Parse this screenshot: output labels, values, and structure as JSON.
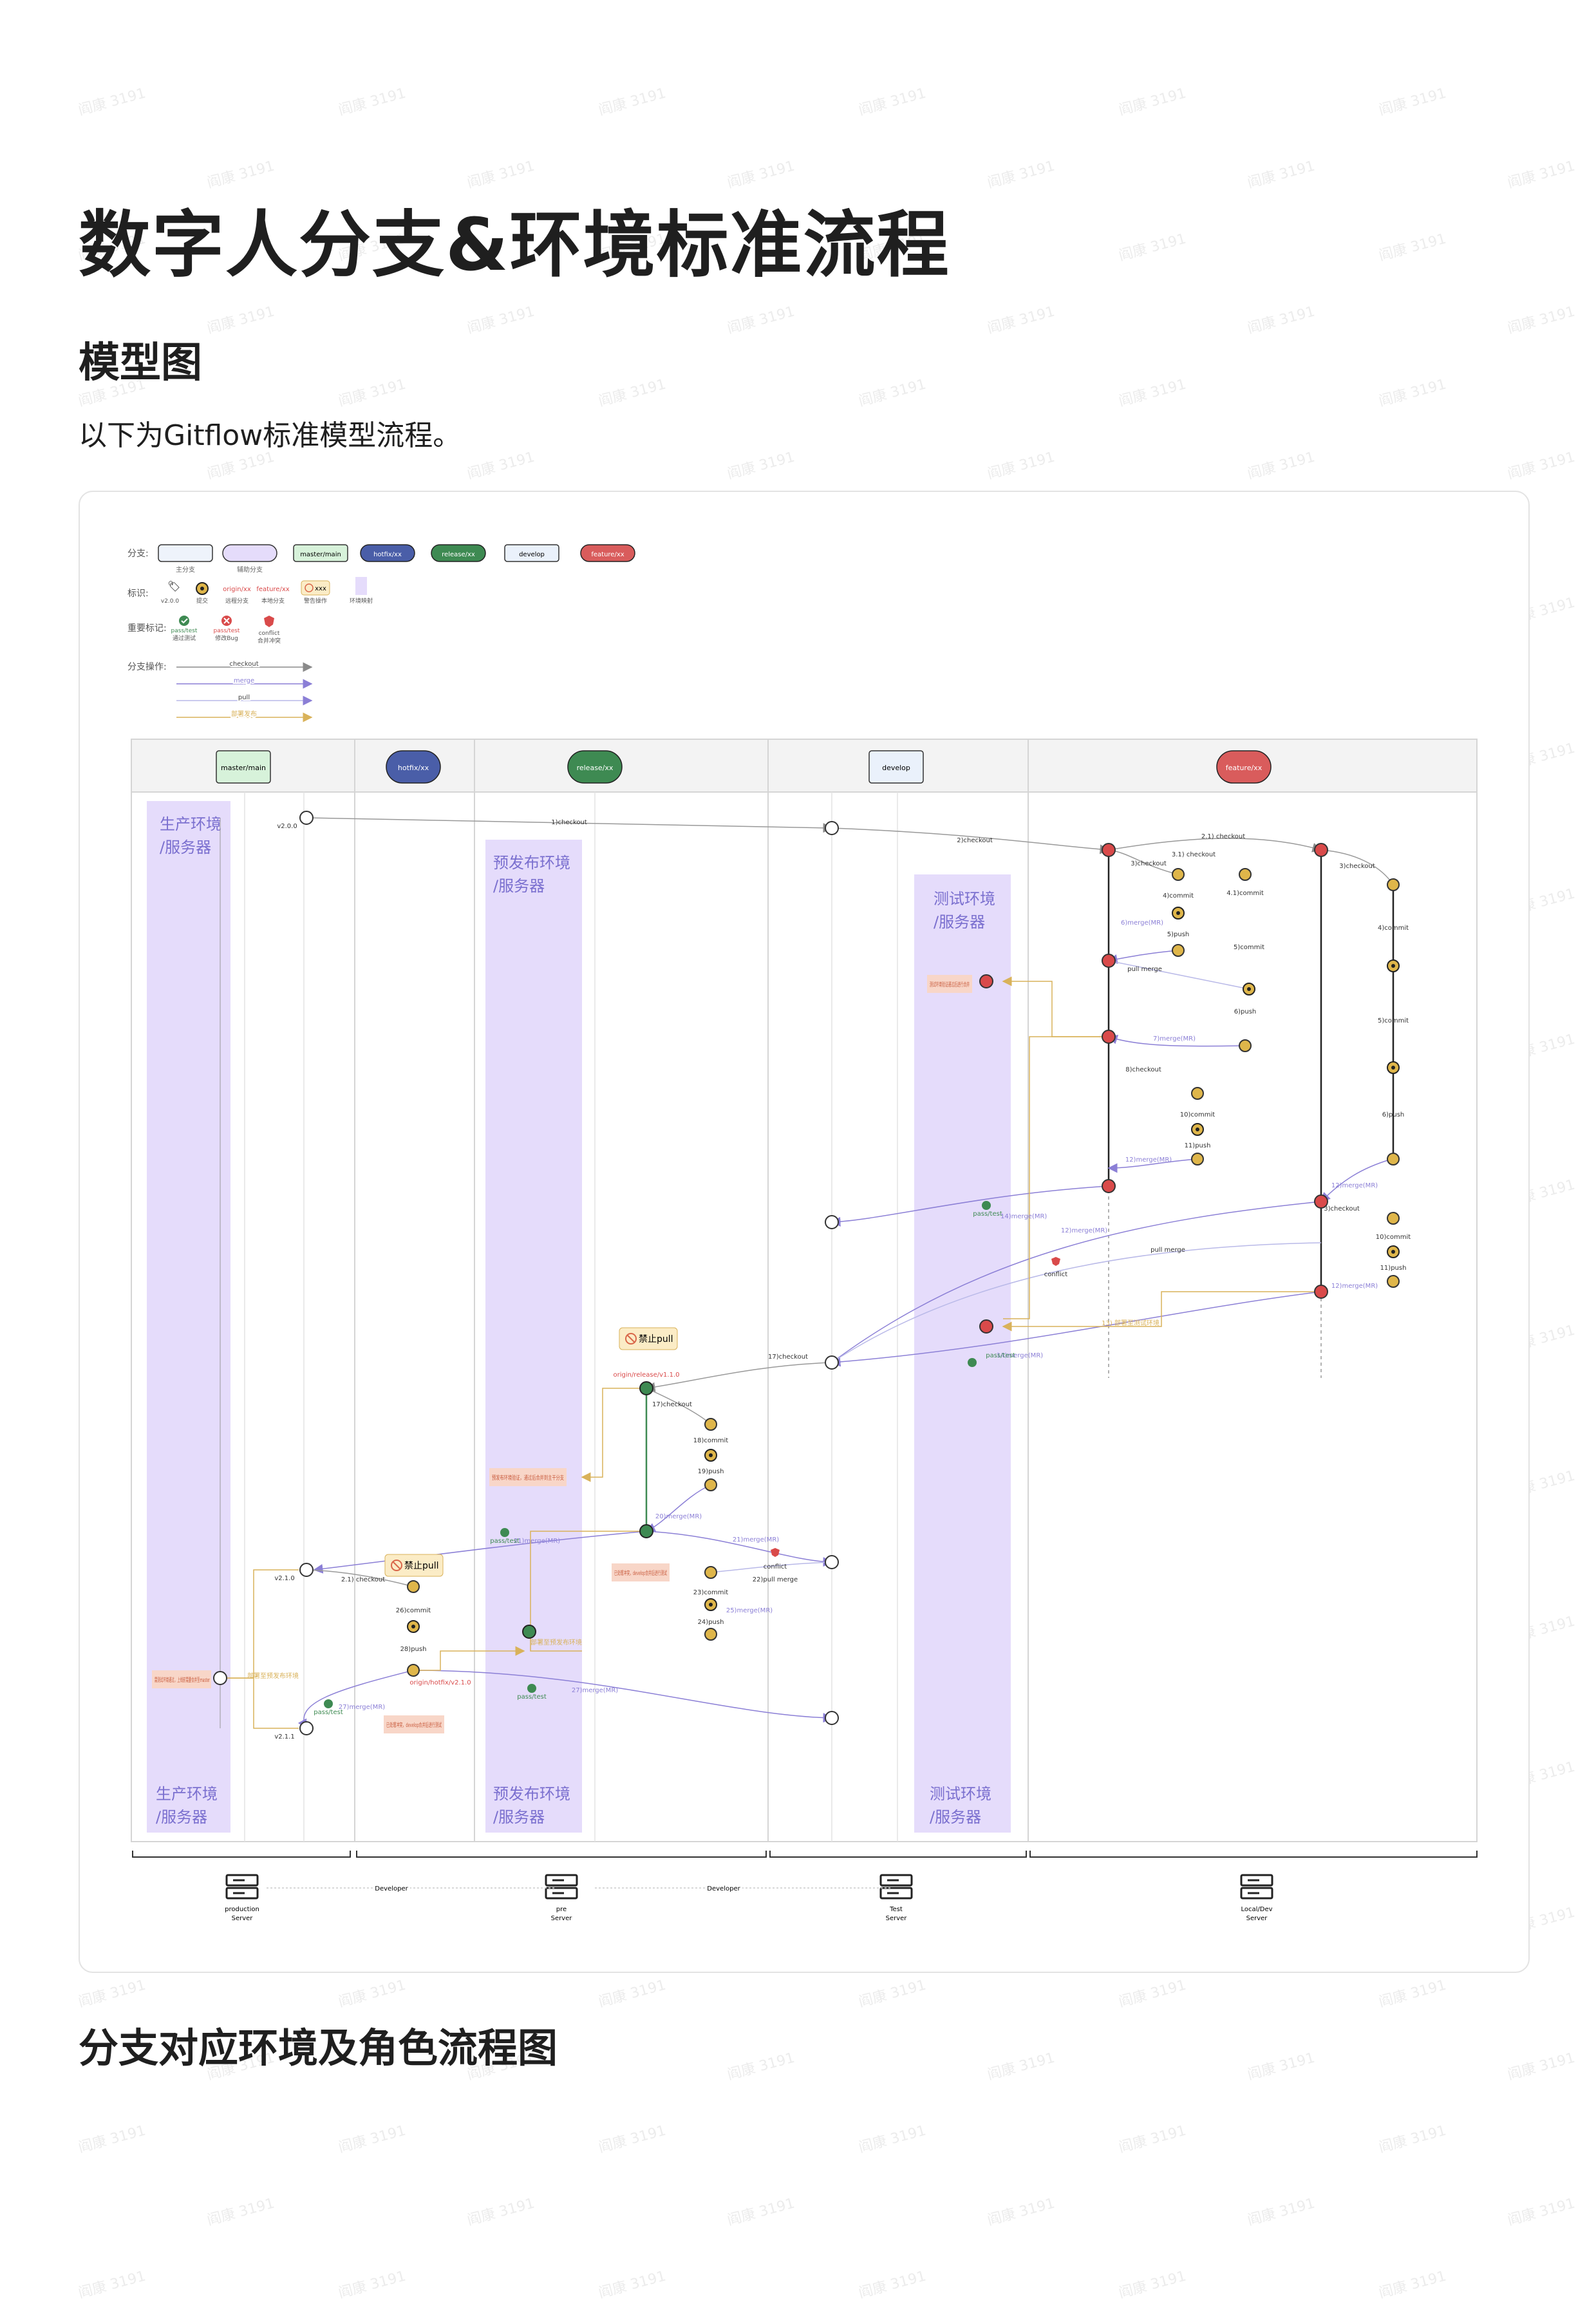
{
  "title": "数字人分支&环境标准流程",
  "section1": {
    "heading": "模型图",
    "text": "以下为Gitflow标准模型流程。"
  },
  "section2": {
    "heading": "分支对应环境及角色流程图"
  },
  "watermark": "阎康 3191",
  "legend": {
    "branch_label": "分支:",
    "branch_types": [
      "master/main",
      "hotfix/xx",
      "release/xx",
      "develop",
      "feature/xx"
    ],
    "branch_sublabels": [
      "主分支",
      "辅助分支"
    ],
    "marker_label": "标识:",
    "marker_items": [
      "v2.0.0",
      "提交",
      "origin/xx",
      "远程分支",
      "feature/xx",
      "本地分支",
      "xxx",
      "警告操作",
      "环境映射"
    ],
    "important_label": "重要标记:",
    "important_items": [
      "pass/test",
      "通过测试",
      "pass/test",
      "修改Bug",
      "conflict",
      "合并冲突"
    ],
    "ops_label": "分支操作:",
    "ops": [
      "checkout",
      "merge",
      "pull",
      "部署发布"
    ]
  },
  "columns": {
    "headers": [
      "master/main",
      "hotfix/xx",
      "release/xx",
      "develop",
      "feature/xx"
    ],
    "colors": {
      "master": "#d7f2da",
      "hotfix": "#4a5ea8",
      "release": "#3e8a52",
      "develop": "#eaf1fb",
      "feature": "#d95c5c",
      "env": "#e5dcfb",
      "merge": "#8b7fd6",
      "deploy": "#d9b25a",
      "node_yellow": "#dfb64a",
      "node_red": "#d94a4a",
      "node_green": "#3e8a52"
    }
  },
  "envs": {
    "prod_top": [
      "生产环境",
      "/服务器"
    ],
    "prod_bottom": [
      "生产环境",
      "/服务器"
    ],
    "pre_top": [
      "预发布环境",
      "/服务器"
    ],
    "pre_bottom": [
      "预发布环境",
      "/服务器"
    ],
    "test_top": [
      "测试环境",
      "/服务器"
    ],
    "test_bottom": [
      "测试环境",
      "/服务器"
    ]
  },
  "forbid_pull": "禁止pull",
  "ops_labels": {
    "l1": "1)checkout",
    "l2": "2)checkout",
    "l21": "2.1) checkout",
    "l3": "3)checkout",
    "l31": "3.1) checkout",
    "l4": "4)commit",
    "l41": "4.1)commit",
    "l5": "5)push",
    "l51": "5)commit",
    "l6": "6)merge(MR)",
    "l61": "6)push",
    "l7": "7)merge(MR)",
    "l8": "8)checkout",
    "l10": "10)commit",
    "l11": "11)push",
    "l12": "12)merge(MR)",
    "l14": "14)merge(MR)",
    "l13": "13) 部署至测试环境",
    "l17": "17)checkout",
    "l18": "18)commit",
    "l19": "19)push",
    "l20": "20)merge(MR)",
    "l21b": "21)merge(MR)",
    "l22": "22)pull merge",
    "l23": "23)commit",
    "l24": "24)push",
    "l25": "25)merge(MR)",
    "l26": "26)commit",
    "l27": "27)merge(MR)",
    "l28": "28)push",
    "pullmerge": "pull merge",
    "conflict": "conflict",
    "pass": "pass/test",
    "release_tag": "origin/release/v1.1.0",
    "hotfix_tag": "origin/hotfix/v2.1.0",
    "v200": "v2.0.0",
    "v210": "v2.1.0",
    "v211": "v2.1.1",
    "prod_note": "需测试环境通过，上线前需要合并至master",
    "pre_note": "预发布环境验证，通过后合并到主干分支",
    "test_note": "测试环境验证通过后进行合并",
    "conflict_note": "已处理冲突，develop合并后进行测试",
    "deploy_note": "部署至预发布环境"
  },
  "servers": [
    {
      "name": "production",
      "sub": "Server"
    },
    {
      "name": "pre",
      "sub": "Server"
    },
    {
      "name": "Test",
      "sub": "Server"
    },
    {
      "name": "Local/Dev",
      "sub": "Server"
    }
  ],
  "roles": [
    "Developer",
    "Developer"
  ]
}
